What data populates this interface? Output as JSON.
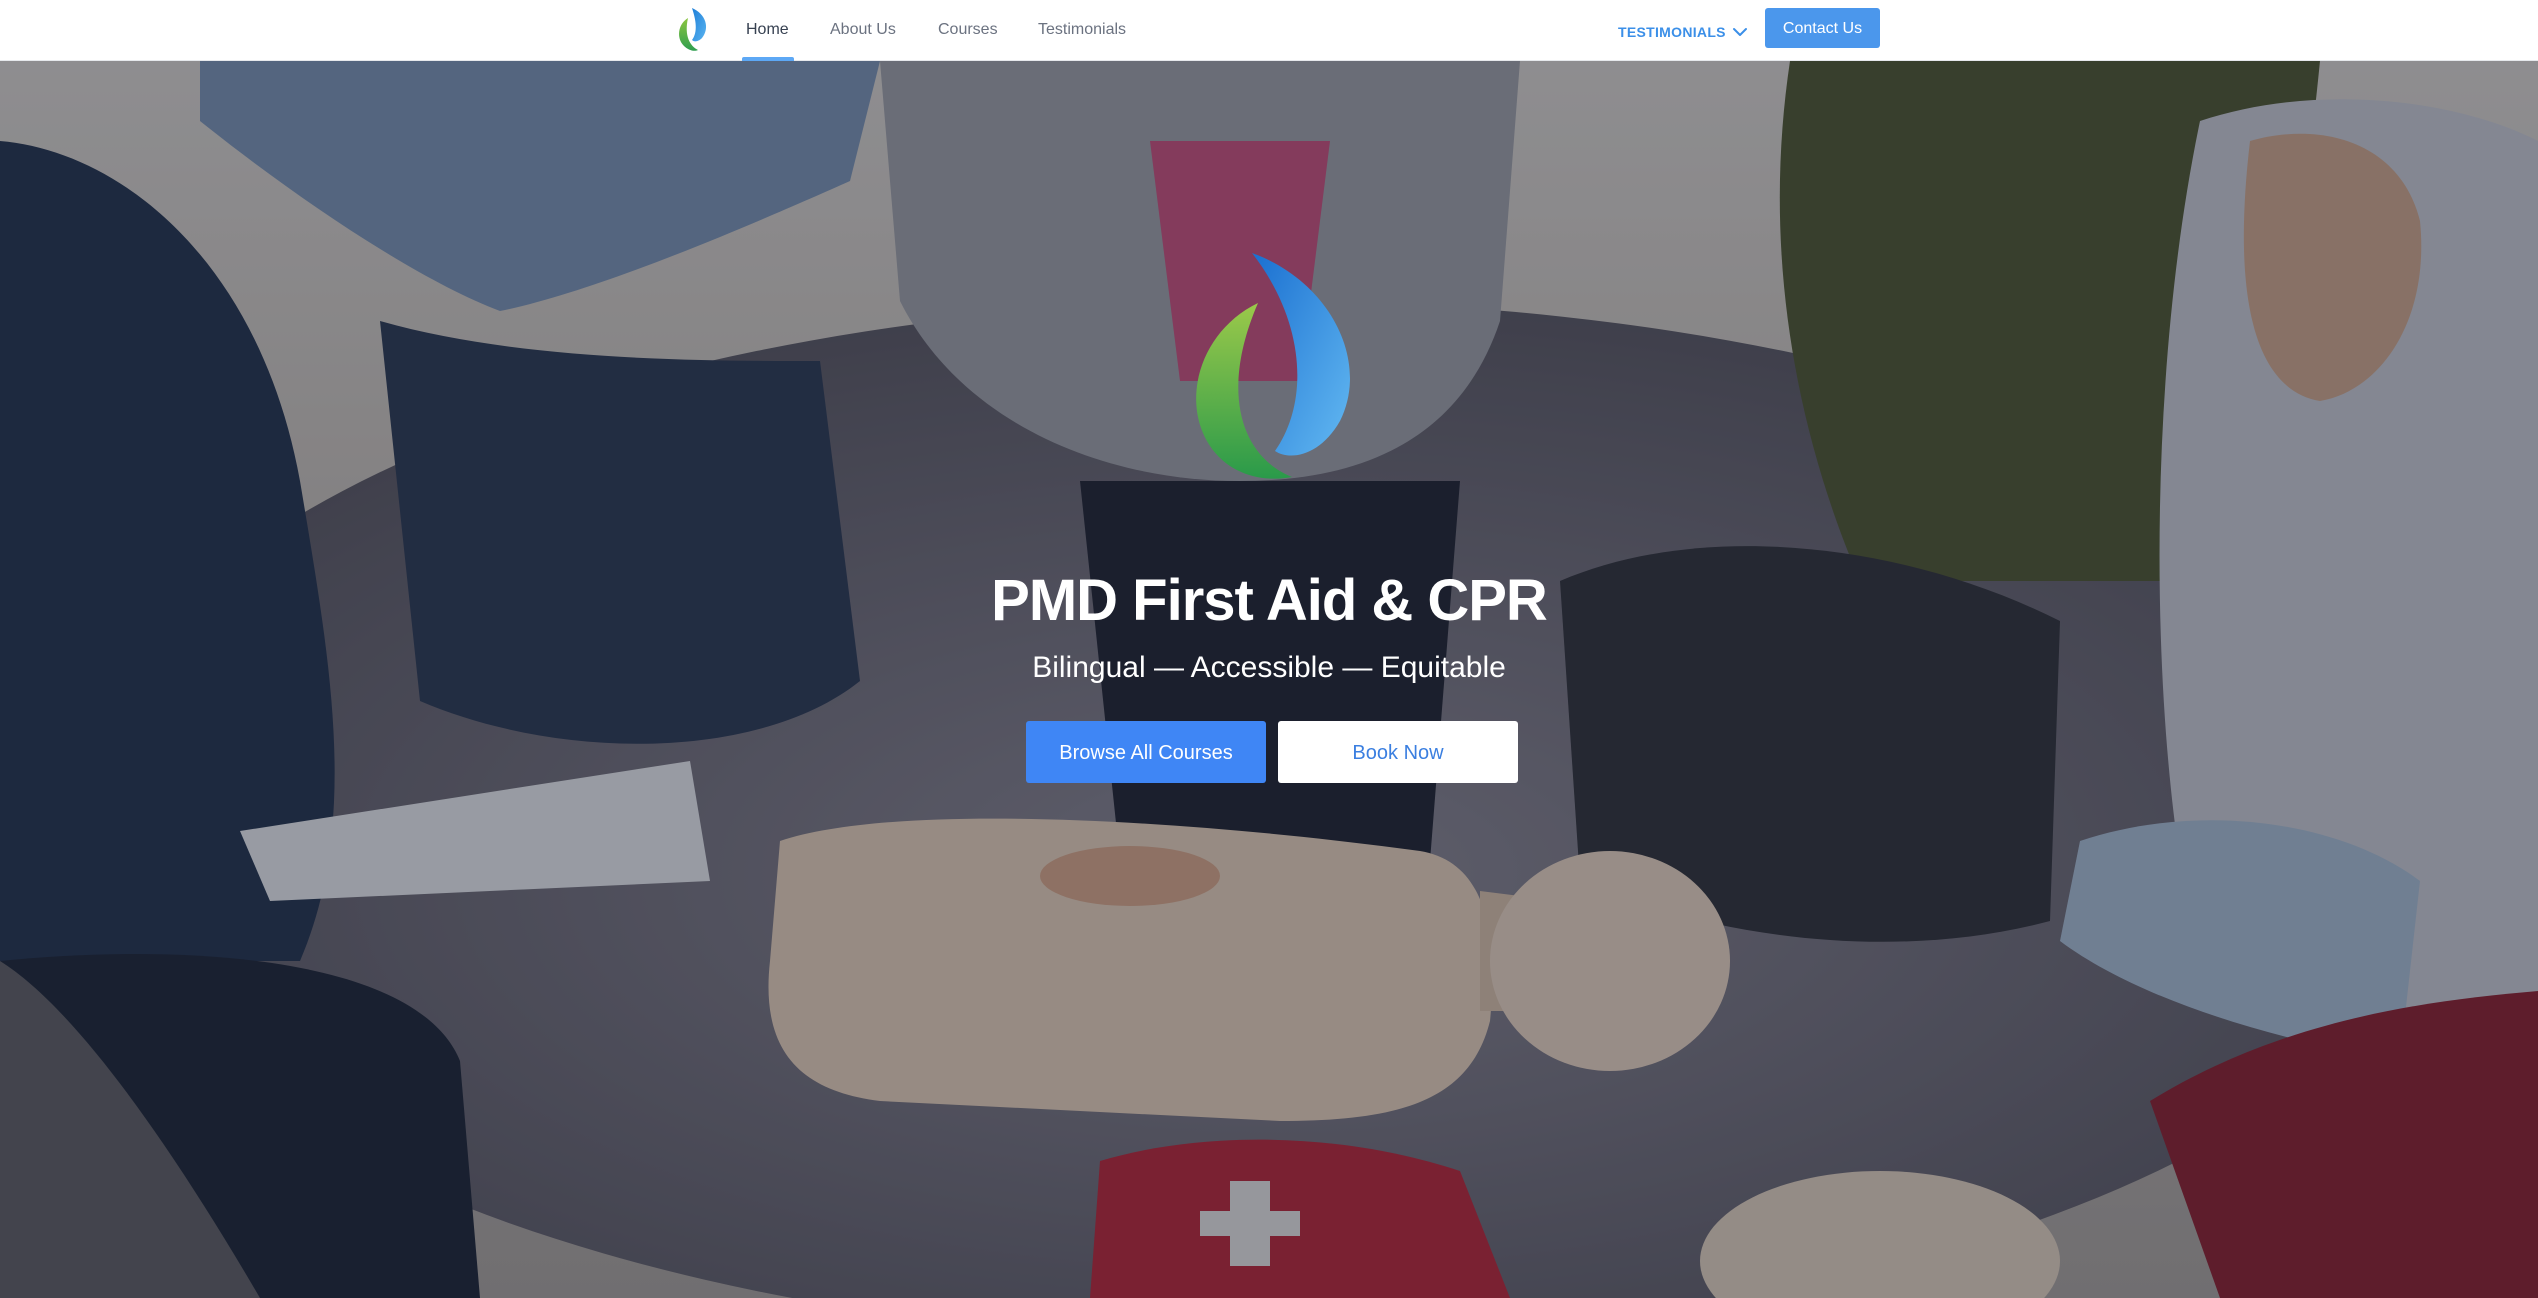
{
  "nav": {
    "logo_icon": "leaf-drop-logo-icon",
    "links": [
      {
        "label": "Home",
        "active": true
      },
      {
        "label": "About Us",
        "active": false
      },
      {
        "label": "Courses",
        "active": false
      },
      {
        "label": "Testimonials",
        "active": false
      }
    ],
    "dropdown": {
      "label": "TESTIMONIALS",
      "icon": "chevron-down-icon"
    },
    "contact_label": "Contact Us",
    "accent_color": "#4b97ec"
  },
  "hero": {
    "background": "cpr-training-class-photo",
    "logo_icon": "leaf-drop-logo-icon",
    "title": "PMD First Aid & CPR",
    "subtitle": "Bilingual — Accessible — Equitable",
    "primary_button": "Browse All Courses",
    "secondary_button": "Book Now",
    "primary_color": "#3f86f5"
  }
}
